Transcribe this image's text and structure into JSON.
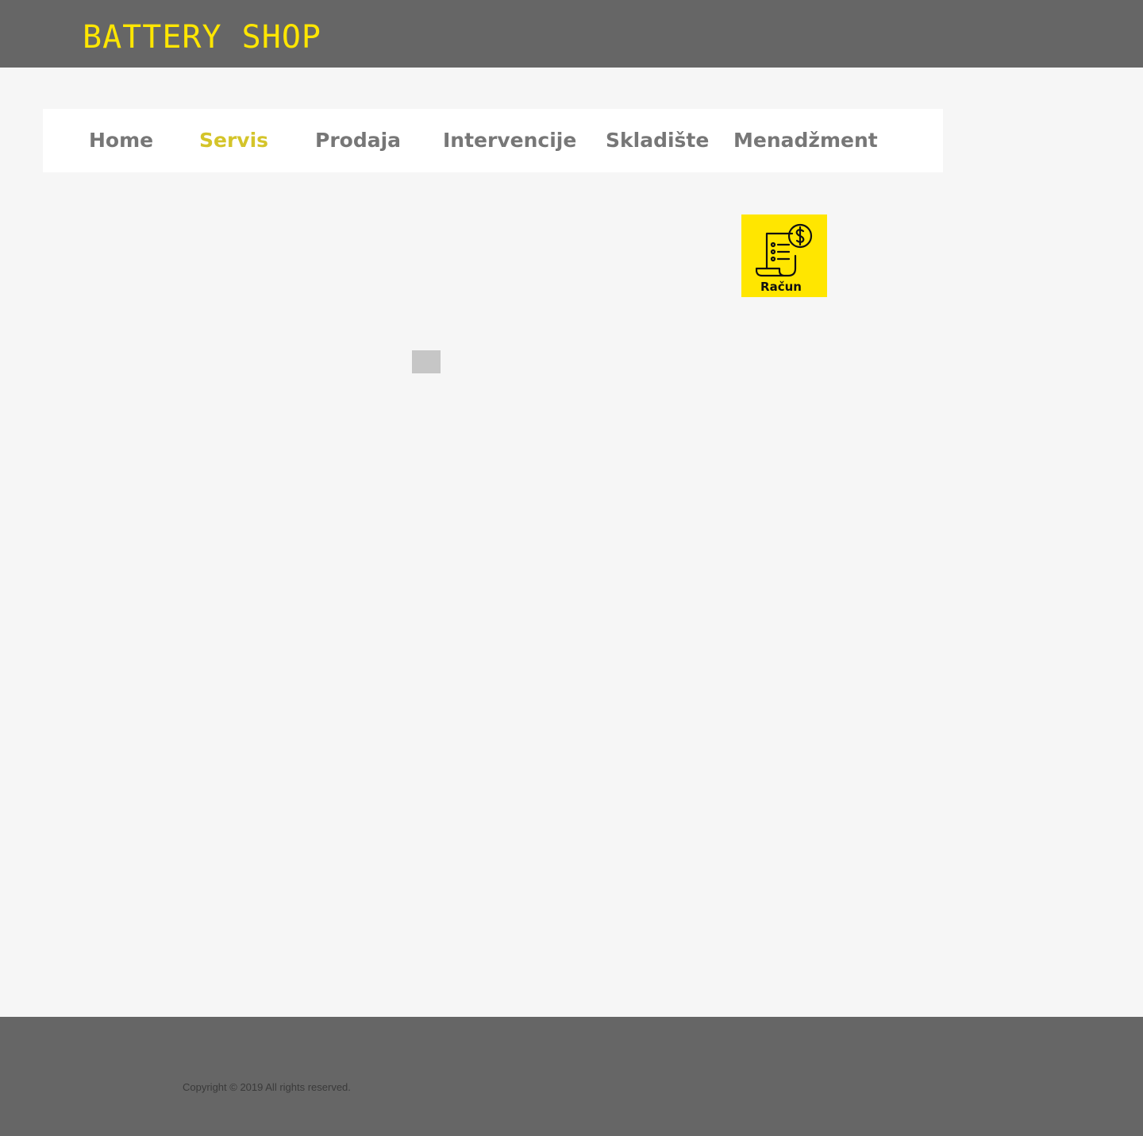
{
  "header": {
    "brand": "BATTERY SHOP",
    "background": "#666666",
    "brand_color": "#ffe600"
  },
  "nav": {
    "items": [
      {
        "label": "Home",
        "active": false
      },
      {
        "label": "Servis",
        "active": true
      },
      {
        "label": "Prodaja",
        "active": false
      },
      {
        "label": "Intervencije",
        "active": false
      },
      {
        "label": "Skladište",
        "active": false
      },
      {
        "label": "Menadžment",
        "active": false
      }
    ],
    "active_color": "#d4c42a",
    "inactive_color": "#777777"
  },
  "tiles": [
    {
      "label": "Račun",
      "icon": "invoice-dollar-icon",
      "background": "#ffe600"
    }
  ],
  "footer": {
    "copyright": "Copyright © 2019 All rights reserved.",
    "background": "#666666"
  }
}
